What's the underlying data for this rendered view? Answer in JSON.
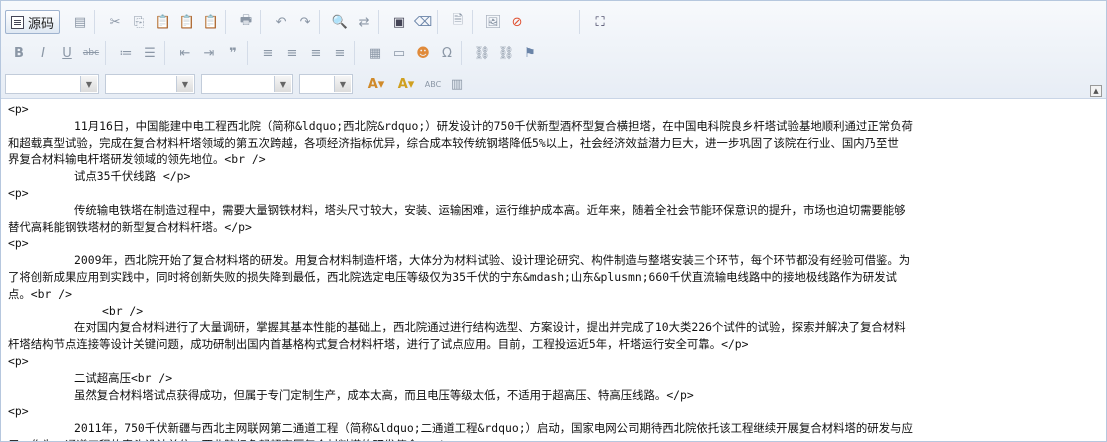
{
  "toolbar": {
    "source_label": "源码",
    "rows": [
      [
        "source",
        "|",
        "page",
        "|",
        "cut",
        "copy",
        "paste",
        "paste-text",
        "paste-word",
        "|",
        "print",
        "|",
        "undo",
        "redo",
        "|",
        "find",
        "replace",
        "|",
        "select-all",
        "remove-format",
        "|",
        "preview",
        "|",
        "image",
        "flash",
        "|",
        "maximize"
      ],
      [
        "bold",
        "italic",
        "underline",
        "strike",
        "|",
        "ordered-list",
        "unordered-list",
        "|",
        "outdent",
        "indent",
        "blockquote",
        "|",
        "align-left",
        "align-center",
        "align-right",
        "align-justify",
        "|",
        "table",
        "horizontal-rule",
        "smiley",
        "special-char",
        "|",
        "link",
        "unlink",
        "anchor"
      ],
      [
        "combo-format",
        "combo-font",
        "combo-size",
        "combo-style",
        "text-color",
        "bg-color",
        "spellcheck",
        "show-blocks"
      ]
    ]
  },
  "lines": [
    {
      "cls": "",
      "text": "<p>"
    },
    {
      "cls": "ind",
      "text": "11月16日，中国能建中电工程西北院（简称&ldquo;西北院&rdquo;）研发设计的750千伏新型酒杯型复合横担塔，在中国电科院良乡杆塔试验基地顺利通过正常负荷"
    },
    {
      "cls": "",
      "text": "和超载真型试验，完成在复合材料杆塔领域的第五次跨越，各项经济指标优异，综合成本较传统钢塔降低5%以上，社会经济效益潜力巨大，进一步巩固了该院在行业、国内乃至世"
    },
    {
      "cls": "",
      "text": "界复合材料输电杆塔研发领域的领先地位。<br />"
    },
    {
      "cls": "ind",
      "text": "试点35千伏线路    </p>"
    },
    {
      "cls": "",
      "text": "<p>"
    },
    {
      "cls": "ind",
      "text": "传统输电铁塔在制造过程中，需要大量钢铁材料，塔头尺寸较大，安装、运输困难，运行维护成本高。近年来，随着全社会节能环保意识的提升，市场也迫切需要能够"
    },
    {
      "cls": "",
      "text": "替代高耗能钢铁塔材的新型复合材料杆塔。</p>"
    },
    {
      "cls": "",
      "text": "<p>"
    },
    {
      "cls": "ind",
      "text": "2009年，西北院开始了复合材料塔的研发。用复合材料制造杆塔，大体分为材料试验、设计理论研究、构件制造与整塔安装三个环节，每个环节都没有经验可借鉴。为"
    },
    {
      "cls": "",
      "text": "了将创新成果应用到实践中，同时将创新失败的损失降到最低，西北院选定电压等级仅为35千伏的宁东&mdash;山东&plusmn;660千伏直流输电线路中的接地极线路作为研发试"
    },
    {
      "cls": "",
      "text": "点。<br />"
    },
    {
      "cls": "ind2",
      "text": "<br />"
    },
    {
      "cls": "ind",
      "text": "在对国内复合材料进行了大量调研，掌握其基本性能的基础上，西北院通过进行结构选型、方案设计，提出并完成了10大类226个试件的试验，探索并解决了复合材料"
    },
    {
      "cls": "",
      "text": "杆塔结构节点连接等设计关键问题，成功研制出国内首基格构式复合材料杆塔，进行了试点应用。目前，工程投运近5年，杆塔运行安全可靠。</p>"
    },
    {
      "cls": "",
      "text": "<p>"
    },
    {
      "cls": "ind",
      "text": "二试超高压<br />"
    },
    {
      "cls": "ind",
      "text": "虽然复合材料塔试点获得成功，但属于专门定制生产，成本太高，而且电压等级太低，不适用于超高压、特高压线路。</p>"
    },
    {
      "cls": "",
      "text": "<p>"
    },
    {
      "cls": "ind",
      "text": "2011年，750千伏新疆与西北主网联网第二通道工程（简称&ldquo;二通道工程&rdquo;）启动，国家电网公司期待西北院依托该工程继续开展复合材料塔的研发与应"
    },
    {
      "cls": "",
      "text": "用。作为二通道工程的牵头设计单位，西北院担负起超高压复合材料塔的研发使命。</p>"
    }
  ]
}
